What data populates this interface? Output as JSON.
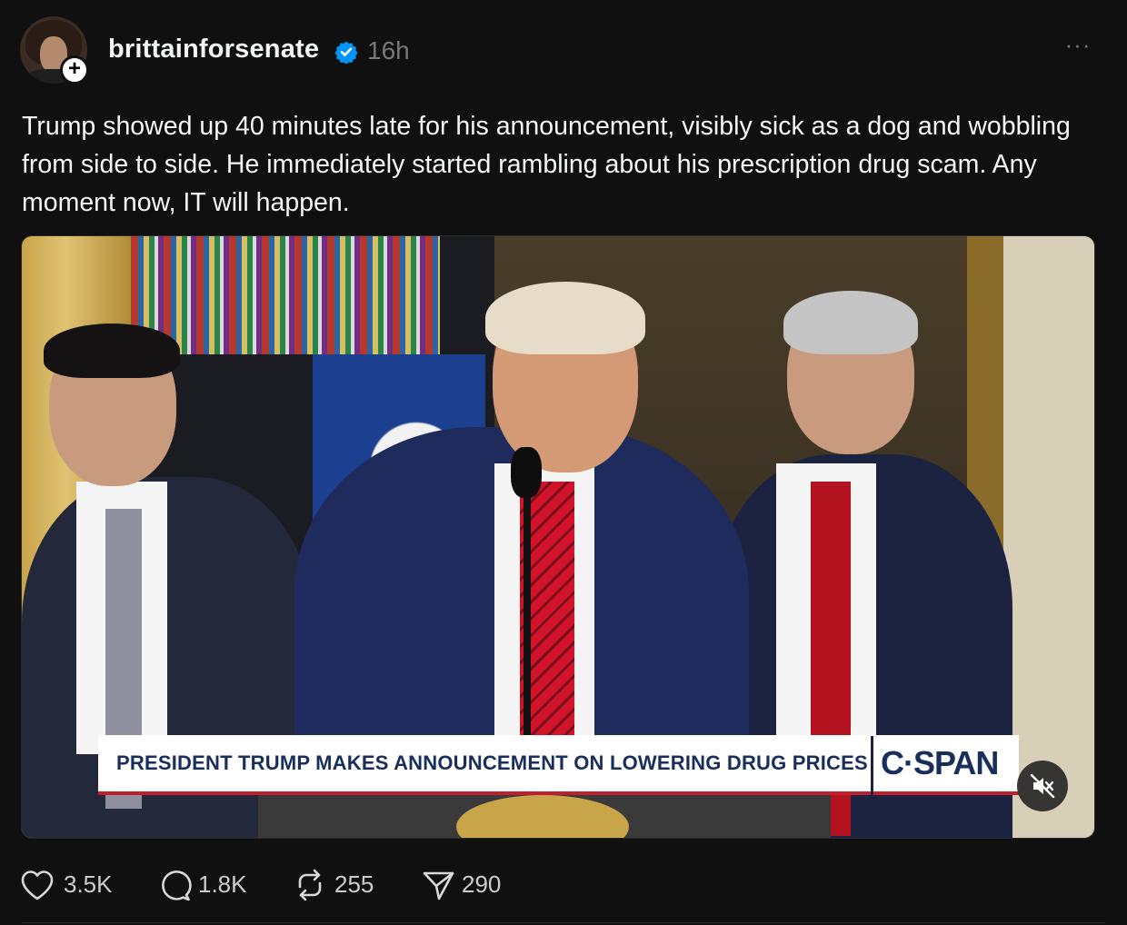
{
  "post": {
    "username": "brittainforsenate",
    "timestamp": "16h",
    "more_label": "···",
    "follow_label": "+",
    "caption": "Trump showed up 40 minutes late for his announcement, visibly sick as a dog and wobbling from side to side. He immediately started rambling about his prescription drug scam. Any moment now, IT will happen."
  },
  "media": {
    "lower_third": "PRESIDENT TRUMP MAKES ANNOUNCEMENT ON LOWERING DRUG PRICES",
    "network": "C·SPAN",
    "muted": true
  },
  "actions": {
    "likes": "3.5K",
    "comments": "1.8K",
    "reposts": "255",
    "shares": "290"
  },
  "colors": {
    "background": "#101010",
    "text": "#f3f5f7",
    "muted_text": "#777777",
    "verified": "#0095f6",
    "chyron_text": "#1a2e5c",
    "chyron_accent": "#c21e2b"
  }
}
